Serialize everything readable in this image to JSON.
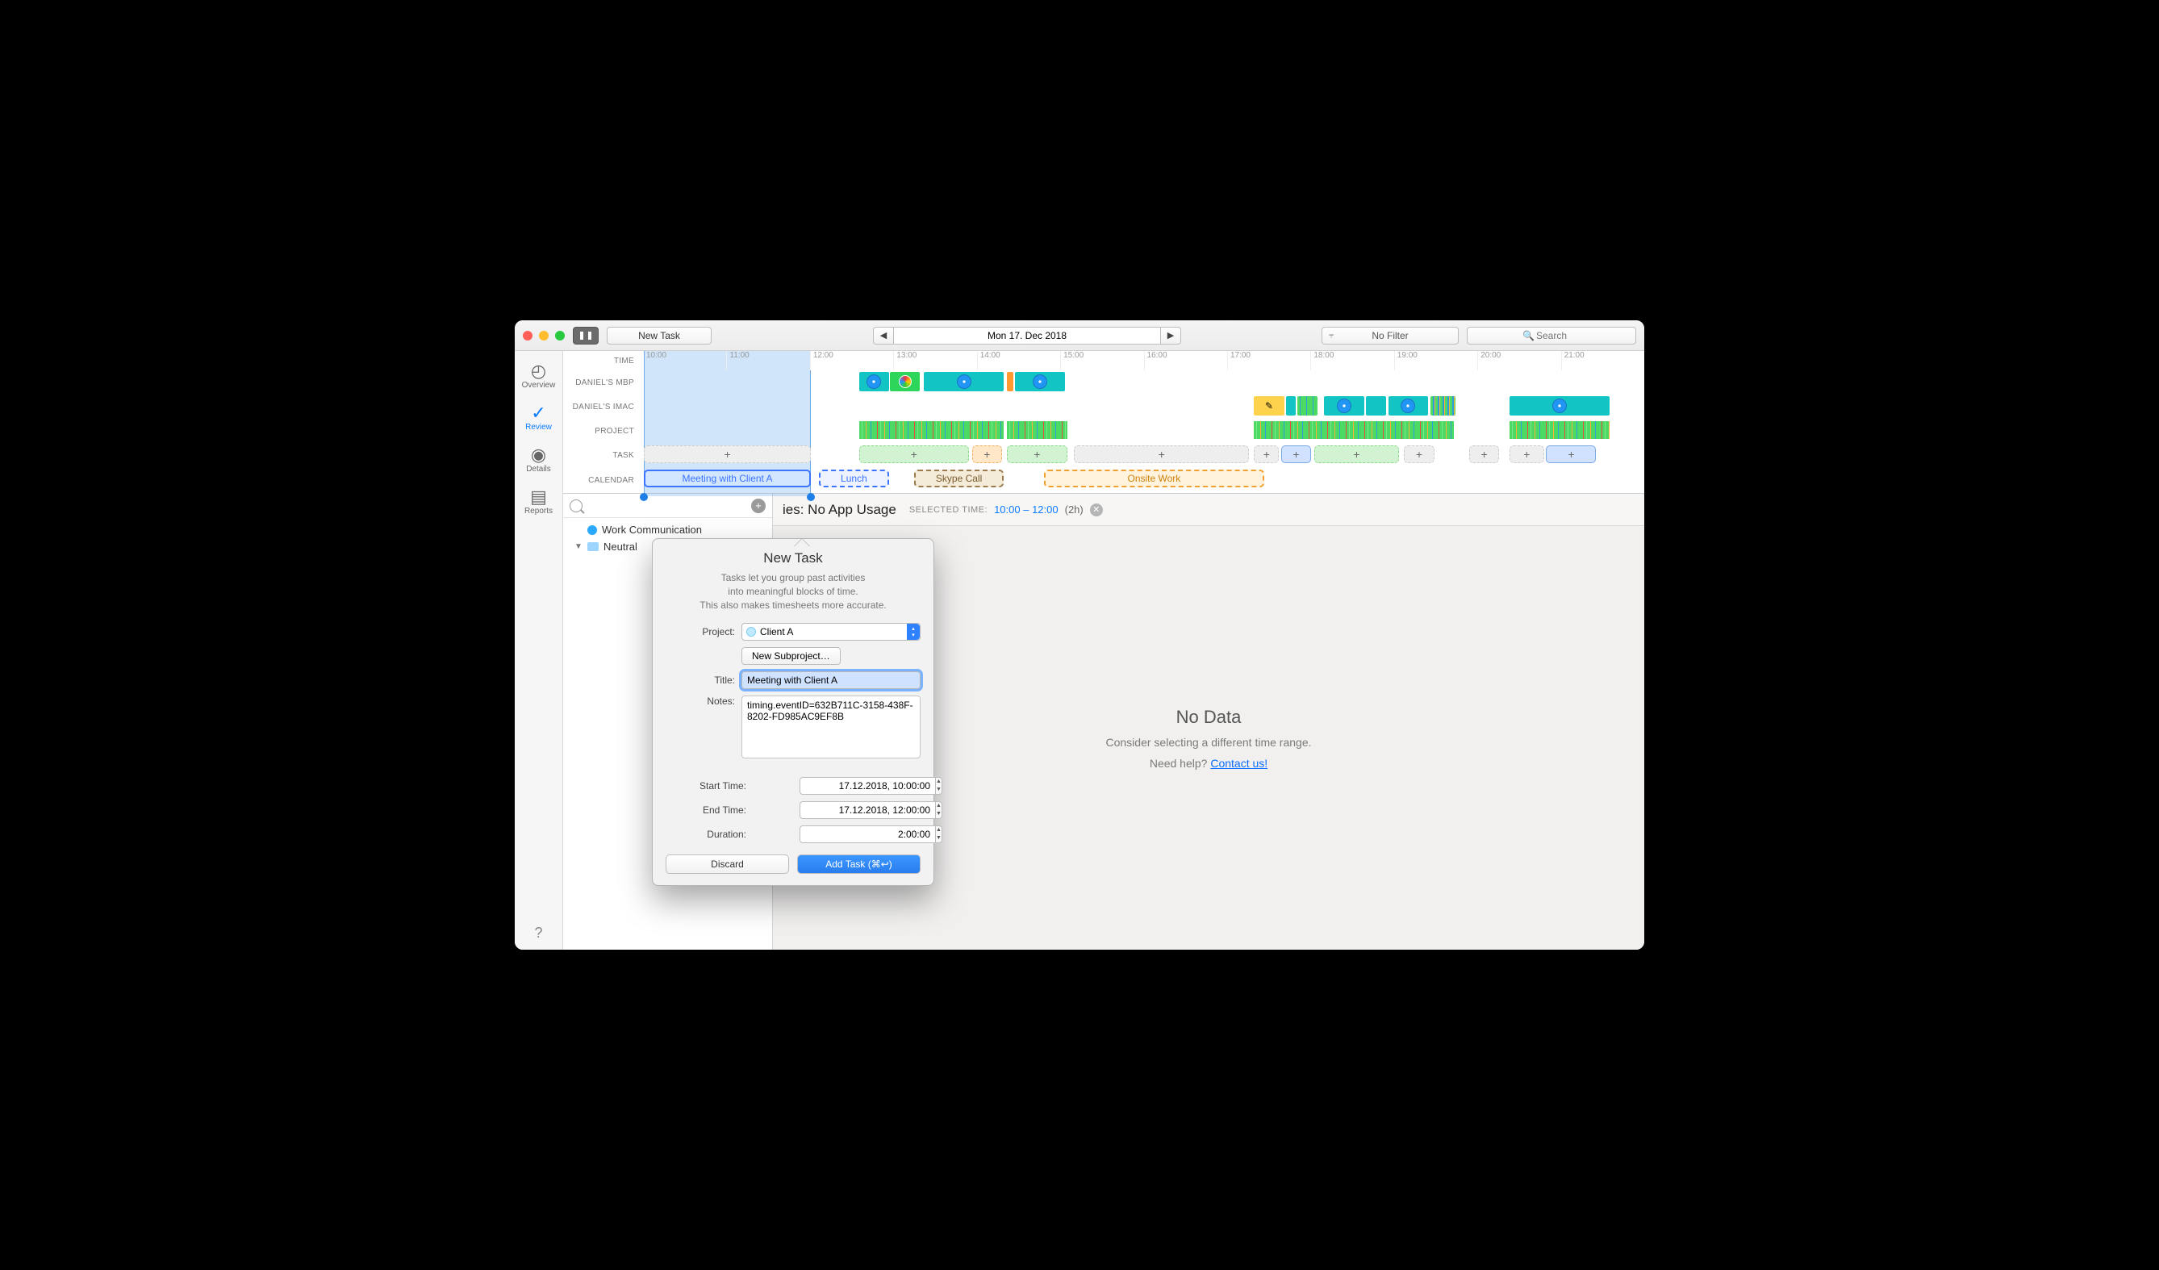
{
  "toolbar": {
    "new_task": "New Task",
    "date": "Mon 17. Dec 2018",
    "filter": "No Filter",
    "search_placeholder": "Search"
  },
  "sidebar": {
    "items": [
      {
        "label": "Overview"
      },
      {
        "label": "Review"
      },
      {
        "label": "Details"
      },
      {
        "label": "Reports"
      }
    ]
  },
  "timeline": {
    "row_labels": {
      "time": "TIME",
      "mbp": "DANIEL'S MBP",
      "imac": "DANIEL'S IMAC",
      "project": "PROJECT",
      "task": "TASK",
      "calendar": "CALENDAR"
    },
    "hours": [
      "10:00",
      "11:00",
      "12:00",
      "13:00",
      "14:00",
      "15:00",
      "16:00",
      "17:00",
      "18:00",
      "19:00",
      "20:00",
      "21:00"
    ],
    "calendar": [
      {
        "label": "Meeting with Client A"
      },
      {
        "label": "Lunch"
      },
      {
        "label": "Skype Call"
      },
      {
        "label": "Onsite Work"
      }
    ]
  },
  "detail": {
    "title_suffix": "ies: No App Usage",
    "selected_label": "SELECTED TIME:",
    "selected_time": "10:00 – 12:00",
    "duration": "(2h)",
    "empty_title": "No Data",
    "empty_line": "Consider selecting a different time range.",
    "empty_help_prefix": "Need help? ",
    "empty_help_link": "Contact us!"
  },
  "projects": {
    "work_comm": "Work Communication",
    "neutral": "Neutral"
  },
  "popover": {
    "title": "New Task",
    "line1": "Tasks let you group past activities",
    "line2": "into meaningful blocks of time.",
    "line3": "This also makes timesheets more accurate.",
    "project_label": "Project:",
    "project_value": "Client A",
    "new_subproject": "New Subproject…",
    "title_label": "Title:",
    "title_value": "Meeting with Client A",
    "notes_label": "Notes:",
    "notes_value": "timing.eventID=632B711C-3158-438F-8202-FD985AC9EF8B",
    "start_label": "Start Time:",
    "start_value": "17.12.2018, 10:00:00",
    "end_label": "End Time:",
    "end_value": "17.12.2018, 12:00:00",
    "duration_label": "Duration:",
    "duration_value": "2:00:00",
    "discard": "Discard",
    "add": "Add Task (⌘↩︎)"
  }
}
